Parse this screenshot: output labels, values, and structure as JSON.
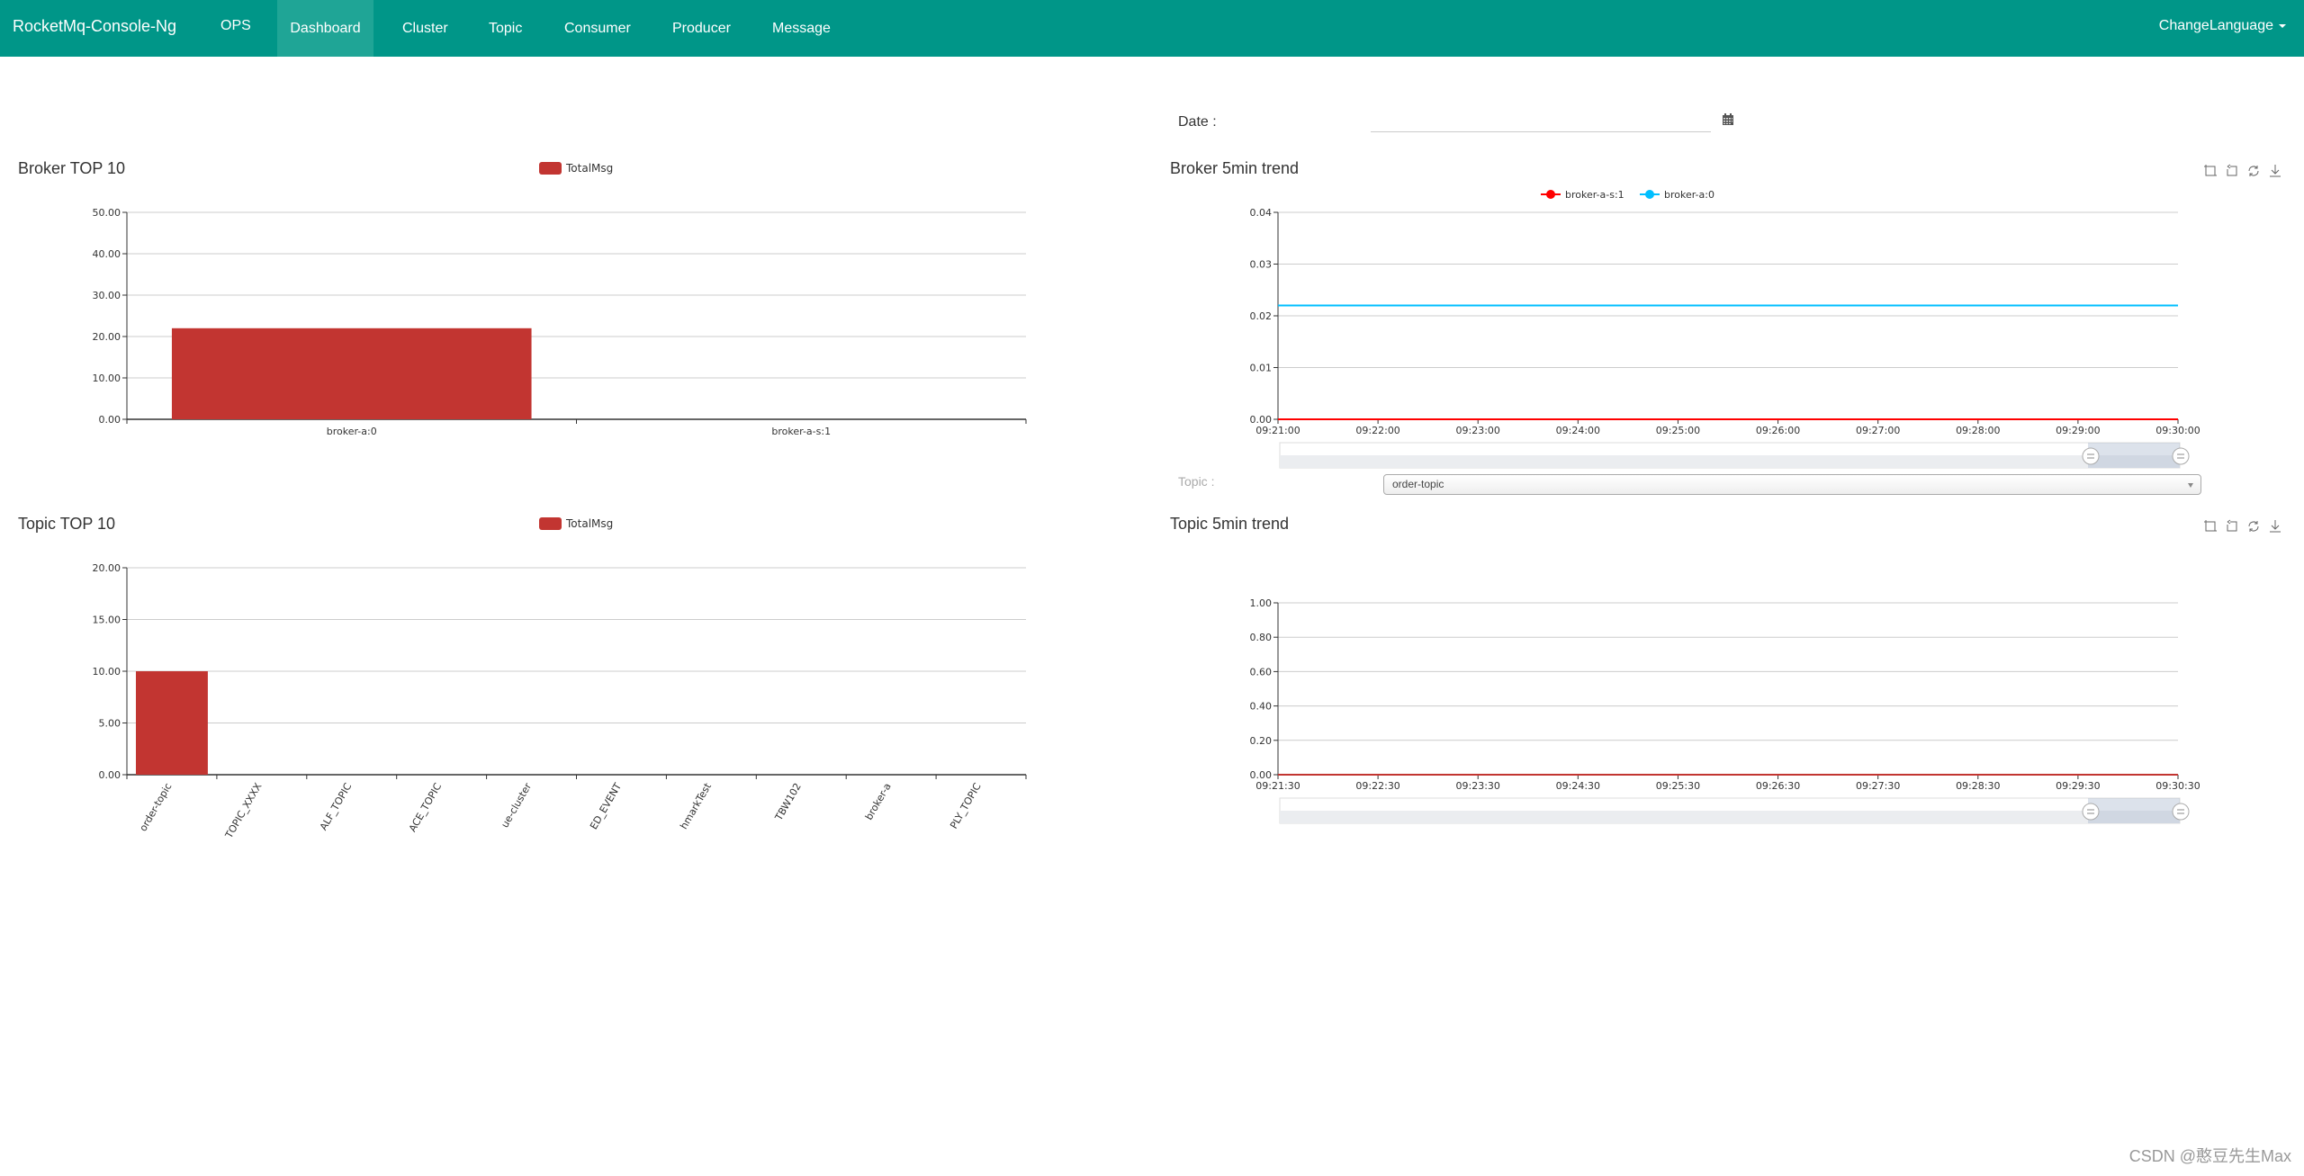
{
  "nav": {
    "brand": "RocketMq-Console-Ng",
    "items": [
      {
        "label": "OPS",
        "active": false
      },
      {
        "label": "Dashboard",
        "active": true
      },
      {
        "label": "Cluster",
        "active": false
      },
      {
        "label": "Topic",
        "active": false
      },
      {
        "label": "Consumer",
        "active": false
      },
      {
        "label": "Producer",
        "active": false
      },
      {
        "label": "Message",
        "active": false
      }
    ],
    "change_language": "ChangeLanguage",
    "color": "#009688"
  },
  "date": {
    "label": "Date :",
    "value": "",
    "icon": "calendar-icon"
  },
  "topic_filter": {
    "label": "Topic :",
    "selected": "order-topic"
  },
  "toolbox_icons": [
    "zoom-icon",
    "zoom-reset-icon",
    "restore-icon",
    "save-image-icon"
  ],
  "watermark": "CSDN @憨豆先生Max",
  "chart_data": [
    {
      "id": "broker-top10",
      "type": "bar",
      "title": "Broker TOP 10",
      "legend": [
        "TotalMsg"
      ],
      "legend_position": "top-center",
      "categories": [
        "broker-a:0",
        "broker-a-s:1"
      ],
      "series": [
        {
          "name": "TotalMsg",
          "values": [
            22,
            0
          ],
          "color": "#c23531"
        }
      ],
      "yticks": [
        "0.00",
        "10.00",
        "20.00",
        "30.00",
        "40.00",
        "50.00"
      ],
      "ylim": [
        0,
        50
      ],
      "grid": true
    },
    {
      "id": "broker-5min-trend",
      "type": "line",
      "title": "Broker 5min trend",
      "legend": [
        "broker-a-s:1",
        "broker-a:0"
      ],
      "legend_position": "top-center",
      "x": [
        "09:21:00",
        "09:22:00",
        "09:23:00",
        "09:24:00",
        "09:25:00",
        "09:26:00",
        "09:27:00",
        "09:28:00",
        "09:29:00",
        "09:30:00"
      ],
      "series": [
        {
          "name": "broker-a-s:1",
          "color": "#ff0000",
          "values": [
            0,
            0,
            0,
            0,
            0,
            0,
            0,
            0,
            0,
            0
          ]
        },
        {
          "name": "broker-a:0",
          "color": "#00bfff",
          "values": [
            0.022,
            0.022,
            0.022,
            0.022,
            0.022,
            0.022,
            0.022,
            0.022,
            0.022,
            0.022
          ]
        }
      ],
      "yticks": [
        "0.00",
        "0.01",
        "0.02",
        "0.03",
        "0.04"
      ],
      "ylim": [
        0,
        0.04
      ],
      "grid": true,
      "datazoom_range": [
        0.9,
        1.0
      ]
    },
    {
      "id": "topic-top10",
      "type": "bar",
      "title": "Topic TOP 10",
      "legend": [
        "TotalMsg"
      ],
      "legend_position": "top-center",
      "categories": [
        "order-topic",
        "TOPIC_XXXX",
        "ALF_TOPIC",
        "ACE_TOPIC",
        "ue-cluster",
        "ED_EVENT",
        "hmarkTest",
        "TBW102",
        "broker-a",
        "PLY_TOPIC"
      ],
      "series": [
        {
          "name": "TotalMsg",
          "values": [
            10,
            0,
            0,
            0,
            0,
            0,
            0,
            0,
            0,
            0
          ],
          "color": "#c23531"
        }
      ],
      "yticks": [
        "0.00",
        "5.00",
        "10.00",
        "15.00",
        "20.00"
      ],
      "ylim": [
        0,
        20
      ],
      "grid": true
    },
    {
      "id": "topic-5min-trend",
      "type": "line",
      "title": "Topic 5min trend",
      "legend": [],
      "x": [
        "09:21:30",
        "09:22:30",
        "09:23:30",
        "09:24:30",
        "09:25:30",
        "09:26:30",
        "09:27:30",
        "09:28:30",
        "09:29:30",
        "09:30:30"
      ],
      "series": [
        {
          "name": "order-topic",
          "color": "#c23531",
          "values": [
            0,
            0,
            0,
            0,
            0,
            0,
            0,
            0,
            0,
            0
          ]
        }
      ],
      "yticks": [
        "0.00",
        "0.20",
        "0.40",
        "0.60",
        "0.80",
        "1.00"
      ],
      "ylim": [
        0,
        1
      ],
      "grid": true,
      "datazoom_range": [
        0.9,
        1.0
      ]
    }
  ]
}
